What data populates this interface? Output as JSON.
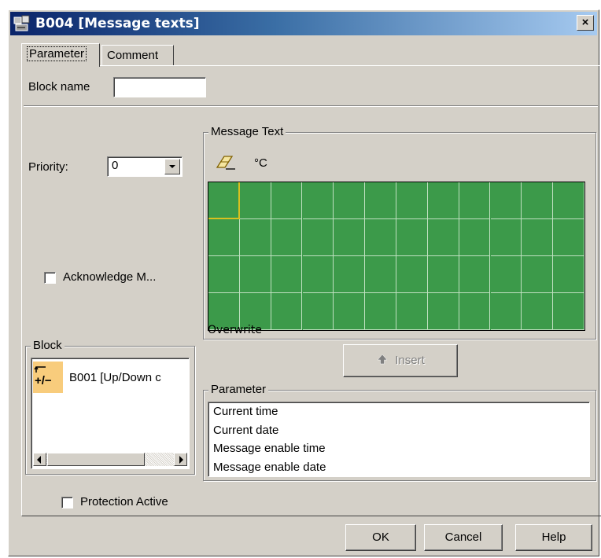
{
  "window": {
    "title": "B004 [Message texts]",
    "close_glyph": "×"
  },
  "tabs": [
    {
      "label": "Parameter",
      "active": true
    },
    {
      "label": "Comment",
      "active": false
    }
  ],
  "block_name": {
    "label": "Block name",
    "value": ""
  },
  "priority": {
    "label": "Priority:",
    "value": "0"
  },
  "acknowledge": {
    "label": "Acknowledge M...",
    "checked": false
  },
  "message_text": {
    "group_label": "Message Text",
    "degree_label": "°C",
    "icons": [
      "eraser-icon"
    ],
    "display": {
      "columns": 12,
      "rows": 4,
      "cursor": {
        "row": 0,
        "col": 0
      },
      "color": "#3c9a4a",
      "cursor_color": "#d8c020"
    },
    "mode_label": "Overwrite"
  },
  "insert_button": {
    "label": "Insert",
    "enabled": false
  },
  "block_group": {
    "label": "Block",
    "items": [
      {
        "icon": "up-down-counter-icon",
        "icon_text": "+/−",
        "label": "B001 [Up/Down c"
      }
    ]
  },
  "parameter_group": {
    "label": "Parameter",
    "items": [
      "Current time",
      "Current date",
      "Message enable time",
      "Message enable date"
    ]
  },
  "protection": {
    "label": "Protection Active",
    "checked": false
  },
  "buttons": {
    "ok": "OK",
    "cancel": "Cancel",
    "help": "Help"
  }
}
